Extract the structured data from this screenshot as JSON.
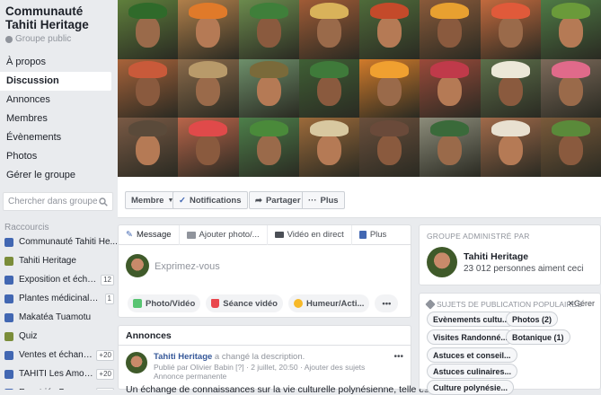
{
  "group": {
    "title": "Communauté Tahiti Heritage",
    "privacy": "Groupe public"
  },
  "nav": [
    {
      "label": "À propos",
      "active": false
    },
    {
      "label": "Discussion",
      "active": true
    },
    {
      "label": "Annonces",
      "active": false
    },
    {
      "label": "Membres",
      "active": false
    },
    {
      "label": "Évènements",
      "active": false
    },
    {
      "label": "Photos",
      "active": false
    },
    {
      "label": "Gérer le groupe",
      "active": false
    }
  ],
  "search": {
    "placeholder": "Chercher dans groupe"
  },
  "shortcuts": {
    "title": "Raccourcis",
    "items": [
      {
        "label": "Communauté Tahiti He...",
        "count": "",
        "icon": "group-icon"
      },
      {
        "label": "Tahiti Heritage",
        "count": "",
        "icon": "page-thumbnail"
      },
      {
        "label": "Exposition et échan...",
        "count": "12",
        "icon": "group-icon"
      },
      {
        "label": "Plantes médicinales ...",
        "count": "1",
        "icon": "group-icon"
      },
      {
        "label": "Makatéa Tuamotu",
        "count": "",
        "icon": "group-icon"
      },
      {
        "label": "Quiz",
        "count": "",
        "icon": "page-thumbnail"
      },
      {
        "label": "Ventes et échange...",
        "count": "+20",
        "icon": "group-icon"
      },
      {
        "label": "TAHITI Les Amour...",
        "count": "+20",
        "icon": "group-icon"
      },
      {
        "label": "Expatriés Bora Bo...",
        "count": "+20",
        "icon": "group-icon"
      }
    ]
  },
  "actions": {
    "member": "Membre",
    "notifications": "Notifications",
    "share": "Partager",
    "more": "Plus"
  },
  "composer": {
    "tabs": [
      "Message",
      "Ajouter photo/...",
      "Vidéo en direct",
      "Plus"
    ],
    "prompt": "Exprimez-vous",
    "pills": [
      "Photo/Vidéo",
      "Séance vidéo",
      "Humeur/Acti...",
      "•••"
    ]
  },
  "announcements": {
    "title": "Annonces",
    "post": {
      "author": "Tahiti Heritage",
      "action": " a changé la description.",
      "meta": "Publié par Olivier Babin [?] · 2 juillet, 20:50 · Ajouter des sujets",
      "pinned": "Annonce permanente",
      "body": "Un échange de connaissances sur la vie culturelle polynésienne, telle est"
    }
  },
  "admin": {
    "title": "GROUPE ADMINISTRÉ PAR",
    "name": "Tahiti Heritage",
    "likes": "23 012 personnes aiment ceci"
  },
  "topics": {
    "title": "SUJETS DE PUBLICATION POPULAIRES",
    "manage": "Gérer",
    "chips": [
      "Evènements cultu...",
      "Photos (2)",
      "Visites Randonné...",
      "Botanique (1)",
      "Astuces et conseil...",
      "Astuces culinaires...",
      "Culture polynésie..."
    ]
  },
  "colors": {
    "accent": "#4267b2",
    "link": "#365899",
    "bg": "#e9ebee"
  }
}
